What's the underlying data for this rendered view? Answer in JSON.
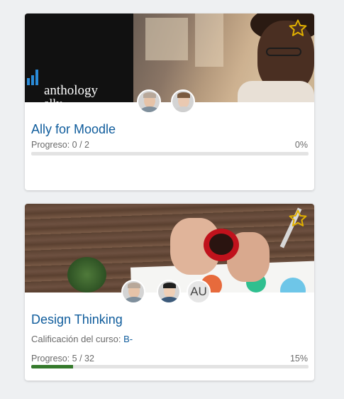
{
  "courses": [
    {
      "title": "Ally for Moodle",
      "banner_logo_text": "anthology",
      "banner_logo_sub": "ally",
      "favorite_icon": "star-outline-icon",
      "avatars": [
        {
          "type": "photo"
        },
        {
          "type": "photo"
        }
      ],
      "progress_label": "Progreso: 0 / 2",
      "progress_pct_text": "0%",
      "progress_fraction": 0.0
    },
    {
      "title": "Design Thinking",
      "favorite_icon": "star-outline-icon",
      "avatars": [
        {
          "type": "photo"
        },
        {
          "type": "photo"
        },
        {
          "type": "initials",
          "initials": "AU"
        }
      ],
      "grade_prefix": "Calificación del curso:",
      "grade_value": "B-",
      "progress_label": "Progreso: 5 / 32",
      "progress_pct_text": "15%",
      "progress_fraction": 0.15
    }
  ],
  "colors": {
    "title_link": "#0f5c9c",
    "progress_fill": "#357a2c",
    "star_outline": "#e0b000",
    "logo_bars": "#2a8bd8"
  }
}
